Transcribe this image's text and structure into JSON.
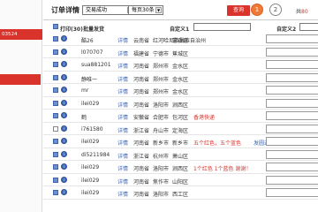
{
  "sidebar": {
    "active_item": "03524"
  },
  "header": {
    "title": "订单详情",
    "status_select": "交易成功",
    "per_page_select": "每页30条",
    "query_button": "查询",
    "pages": [
      "1",
      "2"
    ],
    "total_prefix": "共",
    "total_count": "80"
  },
  "toolbar": {
    "print_label": "打印(30)",
    "bulk_ship_label": "批量发货",
    "custom1_label": "自定义1",
    "custom2_label": "自定义2"
  },
  "colors": {
    "accent": "#d9332b",
    "link": "#3a64b0",
    "step_active": "#f07a35"
  },
  "orders": [
    {
      "user": "酷26",
      "detail": "详情",
      "province": "云南省",
      "city": "红河哈尼族彝族自治州",
      "district": "蒙自县",
      "note": "",
      "tag": "",
      "checked": true,
      "note_color": "#333"
    },
    {
      "user": "l070707",
      "detail": "详情",
      "province": "福建省",
      "city": "宁德市",
      "district": "蕉城区",
      "note": "",
      "tag": "",
      "checked": true,
      "note_color": "#333"
    },
    {
      "user": "sua881201",
      "detail": "详情",
      "province": "河南省",
      "city": "郑州市",
      "district": "金水区",
      "note": "",
      "tag": "",
      "checked": true,
      "note_color": "#333"
    },
    {
      "user": "静唯一",
      "detail": "详情",
      "province": "河南省",
      "city": "郑州市",
      "district": "金水区",
      "note": "",
      "tag": "",
      "checked": true,
      "note_color": "#333"
    },
    {
      "user": "mr",
      "detail": "详情",
      "province": "河南省",
      "city": "郑州市",
      "district": "金水区",
      "note": "",
      "tag": "",
      "checked": true,
      "note_color": "#333"
    },
    {
      "user": "ilei029",
      "detail": "详情",
      "province": "河南省",
      "city": "洛阳市",
      "district": "涧西区",
      "note": "",
      "tag": "",
      "checked": true,
      "note_color": "#333"
    },
    {
      "user": "鹤",
      "detail": "详情",
      "province": "安徽省",
      "city": "合肥市",
      "district": "包河区",
      "note": "香港快递",
      "tag": "",
      "checked": true,
      "note_color": "#d9332b"
    },
    {
      "user": "i761580",
      "detail": "详情",
      "province": "浙江省",
      "city": "舟山市",
      "district": "定海区",
      "note": "",
      "tag": "",
      "checked": false,
      "note_color": "#333"
    },
    {
      "user": "ilei029",
      "detail": "详情",
      "province": "河南省",
      "city": "新乡市",
      "district": "新乡市",
      "note": "五个红色，五个蓝色",
      "tag": "发圆通",
      "checked": true,
      "note_color": "#d9332b"
    },
    {
      "user": "di5211984",
      "detail": "详情",
      "province": "浙江省",
      "city": "杭州市",
      "district": "萧山区",
      "note": "",
      "tag": "",
      "checked": true,
      "note_color": "#333"
    },
    {
      "user": "ilei029",
      "detail": "详情",
      "province": "河南省",
      "city": "洛阳市",
      "district": "涧西区",
      "note": "1个红色 1个蓝色 谢谢！",
      "tag": "",
      "checked": true,
      "note_color": "#d9332b"
    },
    {
      "user": "ilei029",
      "detail": "详情",
      "province": "河南省",
      "city": "焦作市",
      "district": "山阳区",
      "note": "",
      "tag": "",
      "checked": true,
      "note_color": "#333"
    },
    {
      "user": "ilei029",
      "detail": "详情",
      "province": "河南省",
      "city": "洛阳市",
      "district": "西工区",
      "note": "",
      "tag": "",
      "checked": true,
      "note_color": "#333"
    }
  ]
}
